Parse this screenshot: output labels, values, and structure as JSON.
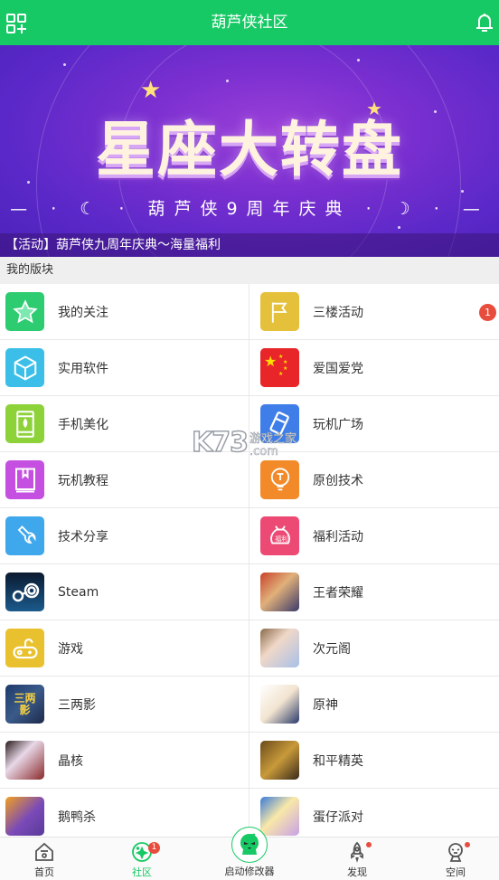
{
  "header": {
    "title": "葫芦侠社区",
    "left_icon": "grid-add-icon",
    "right_icon": "bell-icon",
    "brand_color": "#16c964"
  },
  "banner": {
    "headline": "星座大转盘",
    "subtitle": "葫芦侠9周年庆典",
    "caption": "【活动】葫芦侠九周年庆典～海量福利"
  },
  "section": {
    "title": "我的版块"
  },
  "boards": [
    {
      "label": "我的关注",
      "icon": "star-icon",
      "color": "#2ecc71"
    },
    {
      "label": "三楼活动",
      "icon": "flag-icon",
      "color": "#e5c03a",
      "badge": "1"
    },
    {
      "label": "实用软件",
      "icon": "cube-icon",
      "color": "#3bbfe8"
    },
    {
      "label": "爱国爱党",
      "icon": "china-flag-icon",
      "color": "#e8262a"
    },
    {
      "label": "手机美化",
      "icon": "phone-icon",
      "color": "#8ed23a"
    },
    {
      "label": "玩机广场",
      "icon": "card-icon",
      "color": "#3f7ee8"
    },
    {
      "label": "玩机教程",
      "icon": "book-icon",
      "color": "#c54fe0"
    },
    {
      "label": "原创技术",
      "icon": "bulb-icon",
      "color": "#f28a2a"
    },
    {
      "label": "技术分享",
      "icon": "wrench-icon",
      "color": "#3fa8ec"
    },
    {
      "label": "福利活动",
      "icon": "gift-bag-icon",
      "color": "#ec4a74"
    },
    {
      "label": "Steam",
      "icon": "steam-icon",
      "color": "#0e2a4c"
    },
    {
      "label": "王者荣耀",
      "icon": "game-avatar-icon",
      "color": "#a8452a"
    },
    {
      "label": "游戏",
      "icon": "gamepad-icon",
      "color": "#e9c12e"
    },
    {
      "label": "次元阁",
      "icon": "anime-avatar-icon",
      "color": "#b9c6e8"
    },
    {
      "label": "三两影",
      "icon": "sanliangying-icon",
      "color": "#2a4a7a"
    },
    {
      "label": "原神",
      "icon": "genshin-avatar-icon",
      "color": "#f0e6d8"
    },
    {
      "label": "晶核",
      "icon": "jinghe-avatar-icon",
      "color": "#5a2a2a"
    },
    {
      "label": "和平精英",
      "icon": "pubg-avatar-icon",
      "color": "#8a6a2a"
    },
    {
      "label": "鹅鸭杀",
      "icon": "goose-duck-icon",
      "color": "#7a4ab8"
    },
    {
      "label": "蛋仔派对",
      "icon": "eggy-party-icon",
      "color": "#6aa8e8"
    }
  ],
  "watermark": {
    "logo": "K73",
    "text1": "游戏之家",
    "text2": ".com"
  },
  "bottom_nav": {
    "tabs": [
      {
        "label": "首页",
        "icon": "home-icon"
      },
      {
        "label": "社区",
        "icon": "community-icon",
        "active": true,
        "badge": "1"
      },
      {
        "label": "启动修改器",
        "icon": "launcher-icon"
      },
      {
        "label": "发现",
        "icon": "rocket-icon",
        "dot": true
      },
      {
        "label": "空间",
        "icon": "profile-icon",
        "dot": true
      }
    ]
  }
}
